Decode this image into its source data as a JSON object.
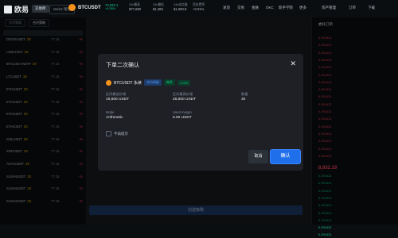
{
  "header": {
    "logo_text": "欧易",
    "mode_tabs": [
      "交易所",
      "Web3 钱包"
    ],
    "pair": "BTCUSDT",
    "price": "74,933.1",
    "change": "+4.28%",
    "stats": [
      {
        "label": "24h最高",
        "value": "$77,850"
      },
      {
        "label": "24h最低",
        "value": "$1,380"
      },
      {
        "label": "24h成交量",
        "value": "$1,080.8"
      },
      {
        "label": "资金费率",
        "value": "+0.01%"
      }
    ],
    "nav": [
      "买币",
      "发现",
      "交易",
      "金融",
      "OKC",
      "新手学院",
      "更多"
    ],
    "right_nav": [
      "资产管理",
      "订单",
      "下载"
    ]
  },
  "left_panel": {
    "tabs": [
      "币币策略",
      "合约策略"
    ],
    "rows": [
      {
        "symbol": "DOGEUSDT",
        "lev": "3X",
        "value": "77.15",
        "change": "-%"
      },
      {
        "symbol": "LINKUSDT",
        "lev": "3X",
        "value": "77.15",
        "change": "-%"
      },
      {
        "symbol": "BTCUSD-SWAP",
        "lev": "3X",
        "value": "77.15",
        "change": "-%"
      },
      {
        "symbol": "LTCUSDT",
        "lev": "3X",
        "value": "77.15",
        "change": "-%"
      },
      {
        "symbol": "ETHUSDT",
        "lev": "3X",
        "value": "77.15",
        "change": "-%"
      },
      {
        "symbol": "ETHUSDT",
        "lev": "3X",
        "value": "77.15",
        "change": "-%"
      },
      {
        "symbol": "ETHUSDT",
        "lev": "3X",
        "value": "77.15",
        "change": "-%"
      },
      {
        "symbol": "ETHUSDT",
        "lev": "3X",
        "value": "77.15",
        "change": "-%"
      },
      {
        "symbol": "SOLUSDT",
        "lev": "3X",
        "value": "77.15",
        "change": "-%"
      },
      {
        "symbol": "XRPUSDT",
        "lev": "3X",
        "value": "77.15",
        "change": "-%"
      },
      {
        "symbol": "AVAXUSDT",
        "lev": "3X",
        "value": "77.15",
        "change": "-%"
      },
      {
        "symbol": "SUSHIUSDT",
        "lev": "3X",
        "value": "77.15",
        "change": "-%"
      },
      {
        "symbol": "SUSHIUSDT",
        "lev": "3X",
        "value": "77.15",
        "change": "-%"
      },
      {
        "symbol": "SUSHIUSDT",
        "lev": "3X",
        "value": "77.15",
        "change": "-%"
      }
    ]
  },
  "orderbook": {
    "title": "委托订单",
    "price": "8,932.19",
    "ask_prices": [
      "0.291421",
      "0.291421",
      "0.291421",
      "0.291421",
      "0.291421",
      "0.291421",
      "0.291421",
      "0.291421",
      "0.291421",
      "0.291421",
      "0.291421",
      "0.291421",
      "0.291421",
      "0.291421",
      "0.291421",
      "0.291421",
      "0.291421"
    ],
    "bid_prices": [
      "0.291421",
      "0.291421",
      "0.291421",
      "0.291421",
      "0.291421",
      "0.291421",
      "0.291421",
      "0.291421",
      "0.291421"
    ]
  },
  "create_button": "创建策略",
  "modal": {
    "title": "下单二次确认",
    "symbol": "BTCUSDT 永续",
    "badge_type": "合约网格",
    "badge_dir": "做多",
    "badge_lev": "1.00X",
    "price_low_label": "区间最低价格",
    "price_low": "19,800 USDT",
    "price_high_label": "区间最高价格",
    "price_high": "28,800 USDT",
    "qty_label": "数量",
    "qty": "30",
    "mode_label": "Mode",
    "mode": "Arithmetic",
    "margin_label": "Used margin",
    "margin": "9.00 USDT",
    "checkbox_label": "不再提示",
    "cancel": "取消",
    "confirm": "确认"
  },
  "colors": {
    "accent": "#1f6feb",
    "up": "#0ecb81",
    "down": "#f6465d",
    "gold": "#f0b90b"
  }
}
